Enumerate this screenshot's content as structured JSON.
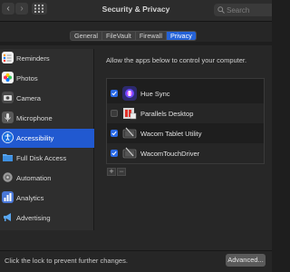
{
  "window": {
    "title": "Security & Privacy"
  },
  "search": {
    "placeholder": "Search"
  },
  "tabs": [
    {
      "label": "General",
      "active": false
    },
    {
      "label": "FileVault",
      "active": false
    },
    {
      "label": "Firewall",
      "active": false
    },
    {
      "label": "Privacy",
      "active": true
    }
  ],
  "sidebar": {
    "items": [
      {
        "label": "Reminders",
        "icon": "reminders-icon",
        "selected": false
      },
      {
        "label": "Photos",
        "icon": "photos-icon",
        "selected": false
      },
      {
        "label": "Camera",
        "icon": "camera-icon",
        "selected": false
      },
      {
        "label": "Microphone",
        "icon": "microphone-icon",
        "selected": false
      },
      {
        "label": "Accessibility",
        "icon": "accessibility-icon",
        "selected": true
      },
      {
        "label": "Full Disk Access",
        "icon": "folder-icon",
        "selected": false
      },
      {
        "label": "Automation",
        "icon": "gear-icon",
        "selected": false
      },
      {
        "label": "Analytics",
        "icon": "analytics-icon",
        "selected": false
      },
      {
        "label": "Advertising",
        "icon": "megaphone-icon",
        "selected": false
      }
    ]
  },
  "main": {
    "description": "Allow the apps below to control your computer.",
    "apps": [
      {
        "name": "Hue Sync",
        "checked": true,
        "icon": "hue-sync-icon"
      },
      {
        "name": "Parallels Desktop",
        "checked": false,
        "icon": "parallels-icon"
      },
      {
        "name": "Wacom Tablet Utility",
        "checked": true,
        "icon": "wacom-tablet-icon"
      },
      {
        "name": "WacomTouchDriver",
        "checked": true,
        "icon": "wacom-touch-icon"
      }
    ],
    "add_label": "+",
    "remove_label": "−"
  },
  "footer": {
    "lock_text": "Click the lock to prevent further changes.",
    "advanced_label": "Advanced..."
  },
  "colors": {
    "accent": "#2159d0",
    "checkbox_on": "#2a6ae6"
  }
}
